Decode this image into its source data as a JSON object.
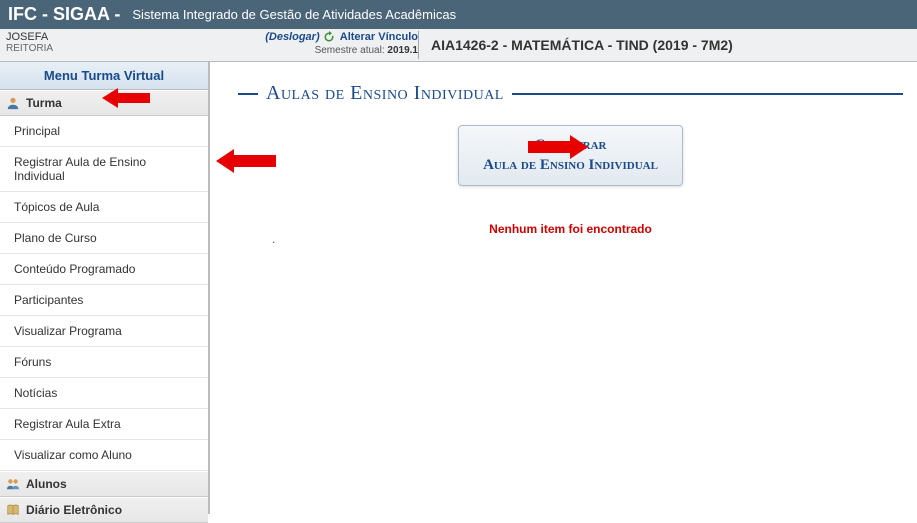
{
  "header": {
    "app_title": "IFC - SIGAA -",
    "app_subtitle": "Sistema Integrado de Gestão de Atividades Acadêmicas"
  },
  "info": {
    "user_name": "JOSEFA",
    "user_sub": "REITORIA",
    "deslogar": "(Deslogar)",
    "alterar": "Alterar Vínculo",
    "semestre_label": "Semestre atual:",
    "semestre_value": "2019.1",
    "course": "AIA1426-2 - MATEMÁTICA - TIND (2019 - 7M2)"
  },
  "sidebar": {
    "menu_header": "Menu Turma Virtual",
    "sections": {
      "turma": "Turma",
      "alunos": "Alunos",
      "diario": "Diário Eletrônico"
    },
    "items": [
      "Principal",
      "Registrar Aula de Ensino Individual",
      "Tópicos de Aula",
      "Plano de Curso",
      "Conteúdo Programado",
      "Participantes",
      "Visualizar Programa",
      "Fóruns",
      "Notícias",
      "Registrar Aula Extra",
      "Visualizar como Aluno"
    ]
  },
  "main": {
    "title": "Aulas de Ensino Individual",
    "button_line1": "Cadastrar",
    "button_line2": "Aula de Ensino Individual",
    "empty": "Nenhum item foi encontrado"
  },
  "colors": {
    "accent": "#1a4a8a",
    "error": "#cc0000",
    "topbar": "#4a6478"
  }
}
